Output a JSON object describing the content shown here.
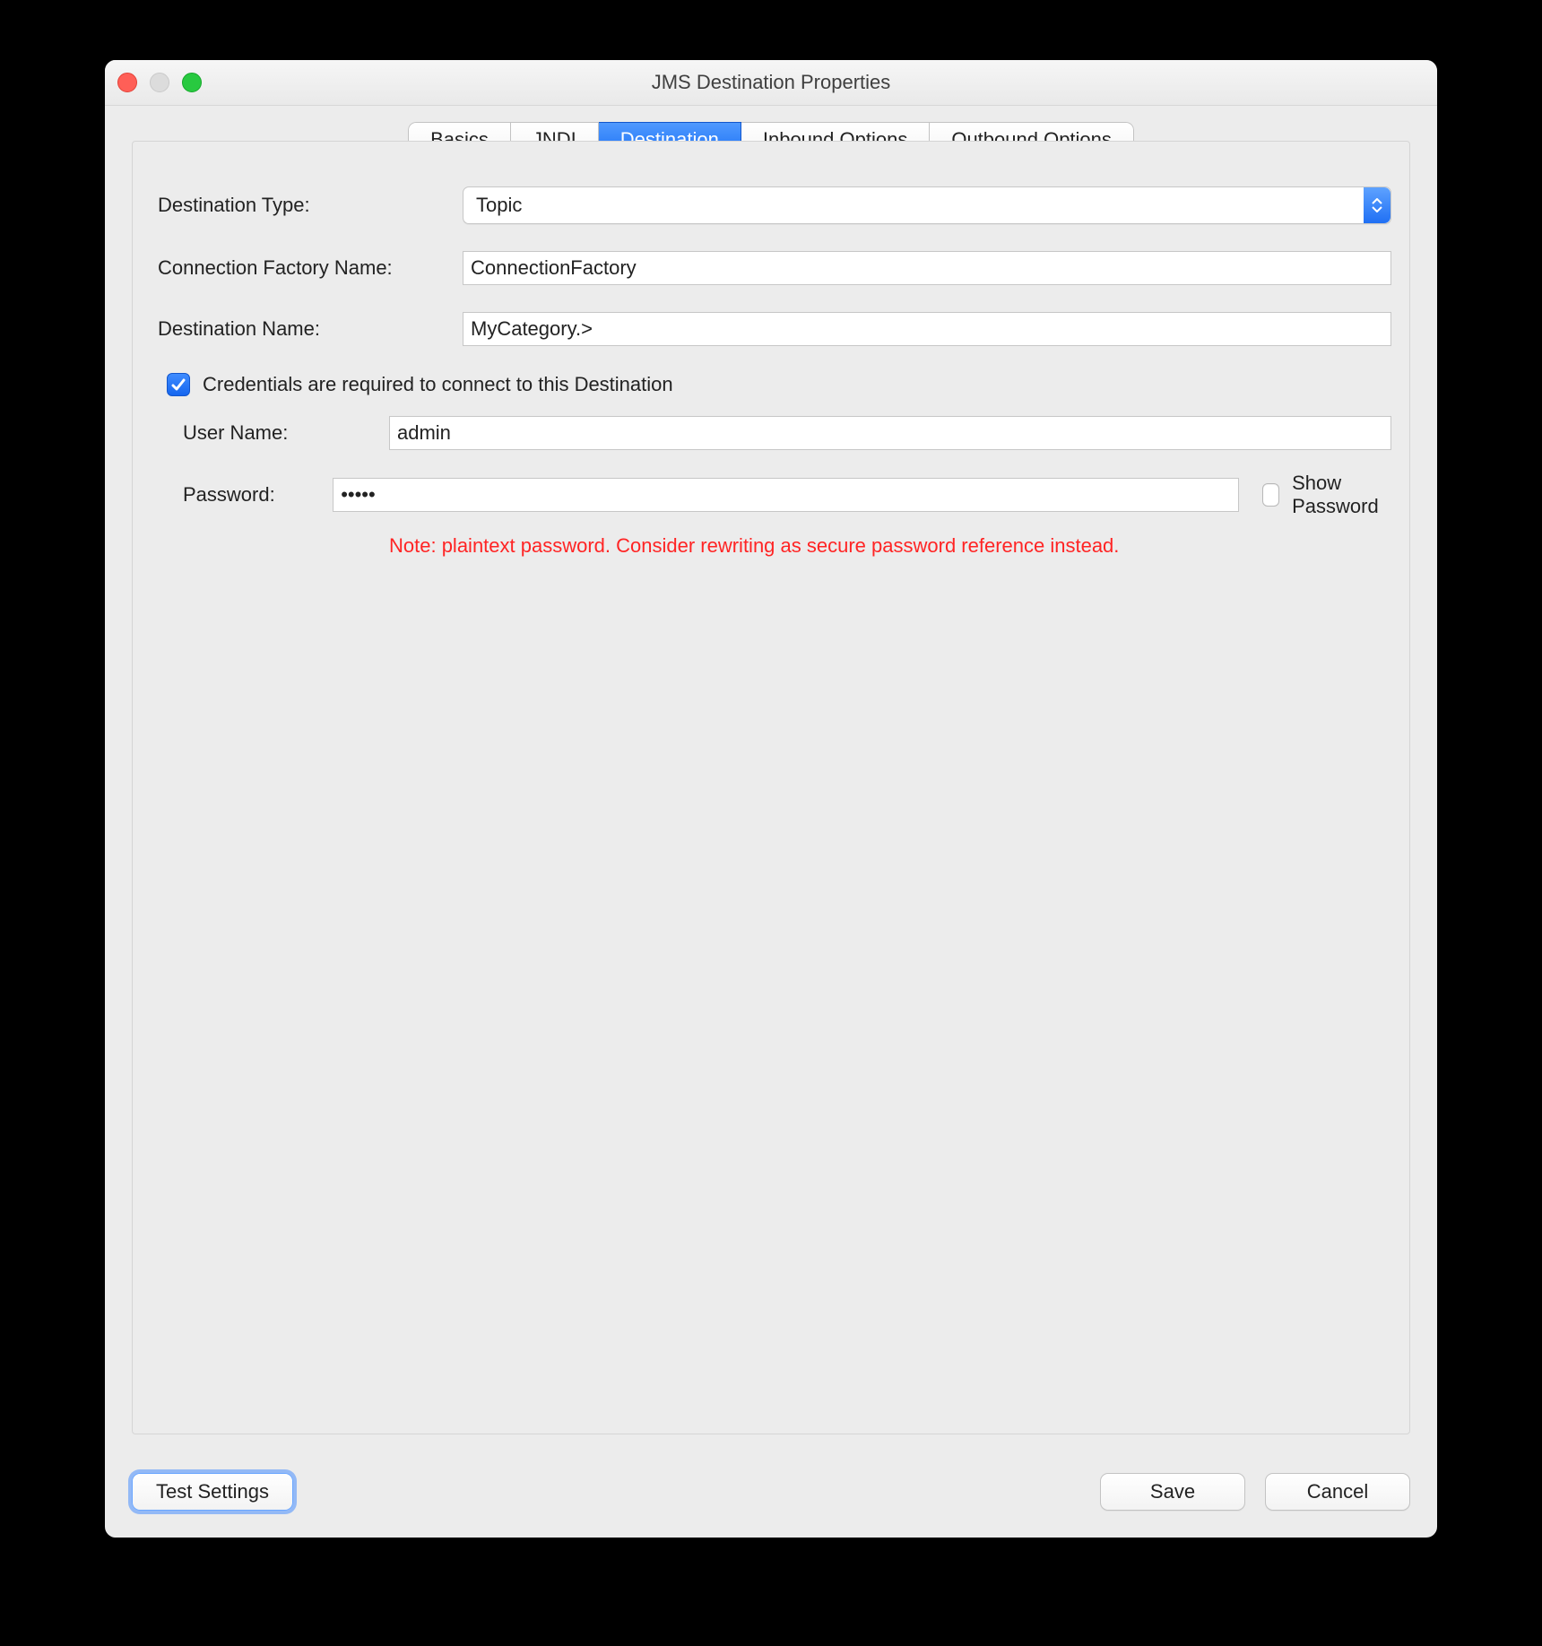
{
  "window": {
    "title": "JMS Destination Properties"
  },
  "tabs": {
    "basics": "Basics",
    "jndi": "JNDI",
    "destination": "Destination",
    "inbound": "Inbound Options",
    "outbound": "Outbound Options",
    "active": "destination"
  },
  "form": {
    "destination_type_label": "Destination Type:",
    "destination_type_value": "Topic",
    "connection_factory_label": "Connection Factory Name:",
    "connection_factory_value": "ConnectionFactory",
    "destination_name_label": "Destination Name:",
    "destination_name_value": "MyCategory.>",
    "credentials_checkbox_label": "Credentials are required to connect to this Destination",
    "credentials_checked": true,
    "username_label": "User Name:",
    "username_value": "admin",
    "password_label": "Password:",
    "password_value": "•••••",
    "show_password_label": "Show Password",
    "show_password_checked": false,
    "warning": "Note: plaintext password. Consider rewriting as secure password reference instead."
  },
  "buttons": {
    "test": "Test Settings",
    "save": "Save",
    "cancel": "Cancel"
  }
}
